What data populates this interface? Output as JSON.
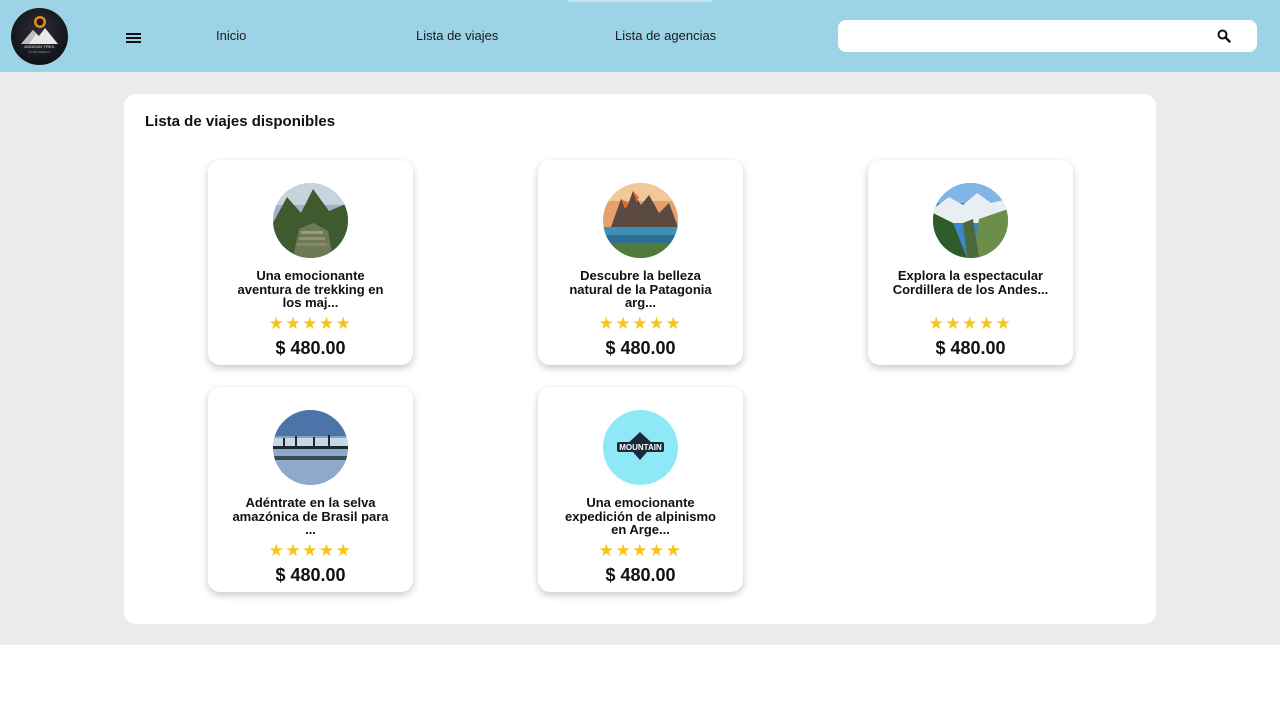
{
  "nav": {
    "logo_text": "ANDEAN TREK",
    "logo_sub": "TOUR AGENCY",
    "links": [
      "Inicio",
      "Lista de viajes",
      "Lista de agencias"
    ],
    "search_placeholder": ""
  },
  "page": {
    "title": "Lista de viajes disponibles"
  },
  "trips": [
    {
      "title": "Una emocionante aventura de trekking en los maj...",
      "rating": 5,
      "stars": "★★★★★",
      "price": "$ 480.00",
      "image": "machu-picchu"
    },
    {
      "title": "Descubre la belleza natural de la Patagonia arg...",
      "rating": 5,
      "stars": "★★★★★",
      "price": "$ 480.00",
      "image": "patagonia"
    },
    {
      "title": "Explora la espectacular Cordillera de los Andes...",
      "rating": 5,
      "stars": "★★★★★",
      "price": "$ 480.00",
      "image": "andes-valley"
    },
    {
      "title": "Adéntrate en la selva amazónica de Brasil para ...",
      "rating": 5,
      "stars": "★★★★★",
      "price": "$ 480.00",
      "image": "amazon-lake"
    },
    {
      "title": "Una emocionante expedición de alpinismo en Arge...",
      "rating": 5,
      "stars": "★★★★★",
      "price": "$ 480.00",
      "image": "mountain-logo"
    }
  ],
  "colors": {
    "navbar": "#9dd3e6",
    "background": "#ebebeb",
    "star": "#f5c518"
  }
}
